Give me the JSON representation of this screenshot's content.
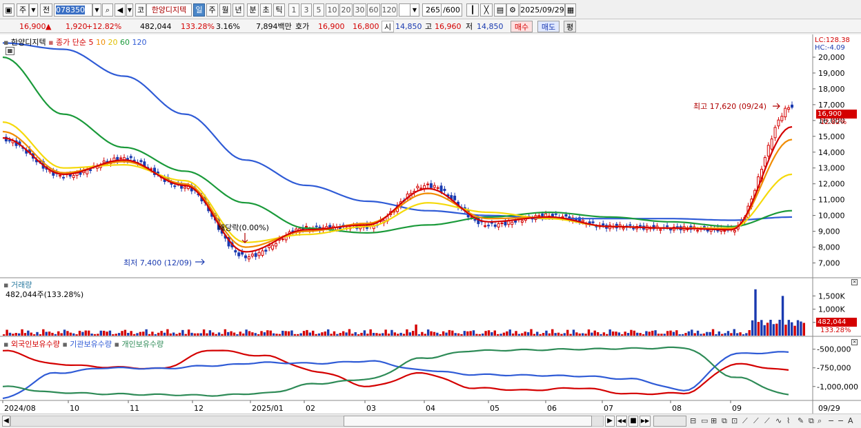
{
  "toolbar": {
    "mode_jo": "주",
    "mode_jeon": "전",
    "code": "078350",
    "company_prefix": "코",
    "company_name": "한양디지텍",
    "periods": [
      "일",
      "주",
      "월",
      "년",
      "분",
      "초",
      "틱"
    ],
    "active_period": "일",
    "intervals": [
      "1",
      "3",
      "5",
      "10",
      "20",
      "30",
      "60",
      "120"
    ],
    "count": "265",
    "count_total": "/600",
    "date": "2025/09/29"
  },
  "info": {
    "price": "16,900",
    "change_arrow": "▲",
    "change": "1,920",
    "change_pct": "+12.82%",
    "volume": "482,044",
    "volume_ratio": "133.28%",
    "turnover": "3.16%",
    "amount": "7,894백만",
    "ask_label": "호가",
    "ask": "16,900",
    "bid": "16,800",
    "open_label": "시",
    "open": "14,850",
    "high_label": "고",
    "high": "16,960",
    "low_label": "저",
    "low": "14,850",
    "buy_button": "매수",
    "sell_button": "매도",
    "eval_button": "평"
  },
  "price_panel": {
    "name": "한양디지텍",
    "ma_label": "종가 단순",
    "ma_periods": [
      "5",
      "10",
      "20",
      "60",
      "120"
    ],
    "ma_colors": [
      "#d40000",
      "#f08c00",
      "#f5d90a",
      "#1a9a3a",
      "#2f5bd6"
    ],
    "lc": "LC:128.38",
    "hc": "HC:-4.09",
    "y_ticks": [
      "20,000",
      "19,000",
      "18,000",
      "17,000",
      "16,000",
      "15,000",
      "14,000",
      "13,000",
      "12,000",
      "11,000",
      "10,000",
      "9,000",
      "8,000",
      "7,000"
    ],
    "current_price_tag": "16,900",
    "current_pct_tag": "12.82%",
    "high_annotation": "최고 17,620 (09/24)",
    "low_annotation": "최저 7,400 (12/09)",
    "dividend_annotation": "배당락(0.00%)"
  },
  "volume_panel": {
    "title": "거래량",
    "value": "482,044주(133.28%)",
    "y_ticks": [
      "1,500K",
      "1,000K",
      "500K"
    ],
    "current_tag": "482,044",
    "current_pct_tag": "133.28%"
  },
  "holder_panel": {
    "labels": [
      "외국인보유수량",
      "기관보유수량",
      "개인보유수량"
    ],
    "colors": [
      "#d40000",
      "#2f5bd6",
      "#2e8b57"
    ],
    "y_ticks": [
      "-500,000",
      "-750,000",
      "-1,000,000"
    ]
  },
  "x_axis": {
    "labels": [
      "2024/08",
      "10",
      "11",
      "12",
      "2025/01",
      "02",
      "03",
      "04",
      "05",
      "06",
      "07",
      "08",
      "09"
    ],
    "right_label": "09/29"
  },
  "chart_data": [
    {
      "type": "line",
      "title": "한양디지텍",
      "x": [
        "2024/08",
        "2024/09",
        "2024/10",
        "2024/11",
        "2024/12",
        "2025/01",
        "2025/02",
        "2025/03",
        "2025/04",
        "2025/05",
        "2025/06",
        "2025/07",
        "2025/08",
        "2025/09"
      ],
      "series": [
        {
          "name": "종가",
          "values": [
            14800,
            12500,
            13600,
            11800,
            7400,
            9200,
            9300,
            11900,
            9400,
            10000,
            9300,
            9200,
            9100,
            16900
          ]
        },
        {
          "name": "5",
          "values": [
            14900,
            12600,
            13500,
            11900,
            7700,
            9100,
            9400,
            11700,
            9600,
            9900,
            9300,
            9200,
            9100,
            15600
          ]
        },
        {
          "name": "10",
          "values": [
            15300,
            12700,
            13400,
            12000,
            8000,
            9000,
            9500,
            11400,
            9800,
            9900,
            9300,
            9200,
            9150,
            14800
          ]
        },
        {
          "name": "20",
          "values": [
            15900,
            13000,
            13200,
            12200,
            8300,
            8800,
            9300,
            10800,
            10200,
            9800,
            9300,
            9200,
            9200,
            12600
          ]
        },
        {
          "name": "60",
          "values": [
            20000,
            16400,
            14300,
            12800,
            10800,
            9200,
            8900,
            9400,
            9900,
            10200,
            9900,
            9600,
            9300,
            10300
          ]
        },
        {
          "name": "120",
          "values": [
            20900,
            20500,
            18800,
            16400,
            13500,
            11900,
            10900,
            10300,
            10000,
            9800,
            9800,
            9800,
            9700,
            9900
          ]
        }
      ],
      "ylim": [
        6500,
        21000
      ],
      "annotations": [
        "최고 17,620 (09/24)",
        "최저 7,400 (12/09)",
        "배당락(0.00%)"
      ]
    },
    {
      "type": "bar",
      "title": "거래량",
      "current": 482044,
      "spikes": [
        {
          "x": "2025/03",
          "value": 420000
        },
        {
          "x": "2025/09",
          "value": 1750000
        },
        {
          "x": "2025/09",
          "value": 1500000
        }
      ],
      "baseline_range": [
        50000,
        250000
      ]
    },
    {
      "type": "line",
      "series": [
        {
          "name": "외국인보유수량"
        },
        {
          "name": "기관보유수량"
        },
        {
          "name": "개인보유수량"
        }
      ]
    }
  ],
  "bottom": {
    "nav_buttons": [
      "▶",
      "◀◀",
      "■",
      "▶▶"
    ]
  }
}
